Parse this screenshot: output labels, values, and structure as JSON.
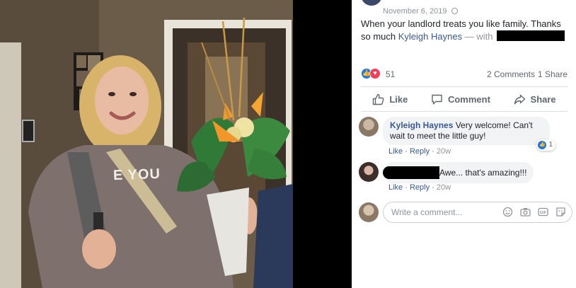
{
  "post": {
    "time": "November 6, 2019",
    "text_main": "When your landlord treats you like family. Thanks so much ",
    "tagged_name": "Kyleigh Haynes",
    "with_text": " — with"
  },
  "reactions": {
    "count": "51",
    "comments_label": "2 Comments",
    "shares_label": "1 Share"
  },
  "actions": {
    "like": "Like",
    "comment": "Comment",
    "share": "Share"
  },
  "comments": [
    {
      "author": "Kyleigh Haynes",
      "text": "Very welcome! Can't wait to meet the little guy!",
      "like_label": "Like",
      "reply_label": "Reply",
      "time": "20w",
      "reaction_count": "1"
    },
    {
      "author": "",
      "text": "Awe... that's amazing!!!",
      "like_label": "Like",
      "reply_label": "Reply",
      "time": "20w"
    }
  ],
  "composer": {
    "placeholder": "Write a comment..."
  },
  "photo": {
    "hoodie_text": "E YOU"
  },
  "colors": {
    "link": "#385898",
    "like_blue": "#1877f2",
    "love_red": "#f33e58",
    "muted": "#606770"
  }
}
